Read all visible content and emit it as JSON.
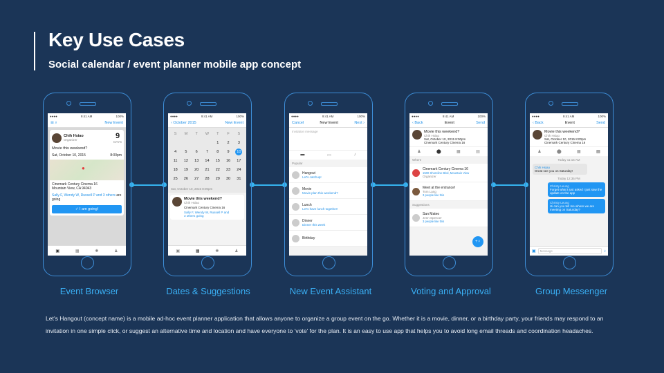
{
  "header": {
    "title": "Key Use Cases",
    "subtitle": "Social calendar / event planner mobile app concept"
  },
  "colors": {
    "background": "#1b3557",
    "accent": "#3ab0f5",
    "phone_outline": "#3e8fd9"
  },
  "phones": [
    {
      "label": "Event Browser",
      "status_time": "9:41 AM",
      "status_battery": "100%",
      "nav_right": "New Event",
      "host_name": "Chih Hsiao",
      "host_role": "Organizer",
      "days_count": "9",
      "days_label": "DAYS",
      "event_title": "Movie this weekend?",
      "event_date": "Sat, October 10, 2015",
      "event_time": "8:00pm",
      "venue_name": "Cinemark Century Cinema 16",
      "venue_city": "Mountain View, CA 94043",
      "attendees": "Sally F, Wendy W, Russell P and",
      "attendees_more": "3 others",
      "attendees_suffix": "are going",
      "cta": "✓  I am going!"
    },
    {
      "label": "Dates & Suggestions",
      "nav_left": "‹ October 2015",
      "nav_right": "New Event",
      "weekdays": [
        "S",
        "M",
        "T",
        "W",
        "T",
        "F",
        "S"
      ],
      "days": [
        "",
        "",
        "",
        "",
        "1",
        "2",
        "3",
        "4",
        "5",
        "6",
        "7",
        "8",
        "9",
        "10",
        "11",
        "12",
        "13",
        "14",
        "15",
        "16",
        "17",
        "18",
        "19",
        "20",
        "21",
        "22",
        "23",
        "24",
        "25",
        "26",
        "27",
        "28",
        "29",
        "30",
        "31"
      ],
      "selected_day": "10",
      "selected_date": "Sat, October 10, 2015  8:00pm",
      "event_title": "Movie this weekend?",
      "host_name": "Chih Hsiao",
      "venue_name": "Cinemark Century Cinema 16",
      "attendees": "Sally F, Wendy W, Russell P and",
      "attendees_more": "3 others going"
    },
    {
      "label": "New Event Assistant",
      "nav_left": "Cancel",
      "nav_title": "New Event",
      "nav_right": "Next ›",
      "input_placeholder": "Invitation message",
      "section_title": "Popular",
      "items": [
        {
          "title": "Hangout",
          "subtitle": "Let's catchup!"
        },
        {
          "title": "Movie",
          "subtitle": "Movie plan this weekend?"
        },
        {
          "title": "Lunch",
          "subtitle": "Let's have lunch together!"
        },
        {
          "title": "Dinner",
          "subtitle": "Dinner this week"
        },
        {
          "title": "Birthday",
          "subtitle": ""
        }
      ]
    },
    {
      "label": "Voting and Approval",
      "nav_left": "‹ Back",
      "nav_title": "Event",
      "nav_right": "Send",
      "event_title": "Movie this weekend?",
      "host_name": "Chih Hsiao",
      "event_date": "Sat, October 10, 2015  8:00pm",
      "venue_name": "Cinemark Century Cinema 16",
      "where_label": "Where",
      "where_title": "Cinemark Century Cinema 16",
      "where_address": "1500 Shoreline Blvd, Mountain View",
      "where_role": "Organizer",
      "where2_title": "Meet at the entrance!",
      "where2_sub": "Tom Lang",
      "where2_votes": "3 people like this",
      "suggestions_label": "Suggestions",
      "sugg_title": "San Mateo",
      "sugg_sub": "Jenn Spencer",
      "sugg_votes": "3 people like this",
      "fab": "+♀"
    },
    {
      "label": "Group Messenger",
      "nav_left": "‹ Back",
      "nav_title": "Event",
      "nav_right": "Send",
      "event_title": "Movie this weekend?",
      "host_name": "Chih Hsiao",
      "event_date": "Sat, October 10, 2015  8:00pm",
      "venue_name": "Cinemark Century Cinema 16",
      "time1": "Today 11:15 AM",
      "msg1_name": "Chih Hsiao",
      "msg1_text": "Great see you on Saturday!",
      "time2": "Today 12:35 PM",
      "msg2_name": "Christy Leung",
      "msg2_text": "Forget what I just asked I just saw the update on the app",
      "msg3_name": "Christy Leung",
      "msg3_text": "Hi can you tell me where we are meeting on Saturday?",
      "input_placeholder": "Message"
    }
  ],
  "description": "Let's Hangout (concept name) is a mobile ad-hoc event planner application that allows anyone to organize a group event on the go. Whether it is a movie, dinner, or a birthday party, your friends may respond to an invitation in one simple click, or suggest an alternative time and location and have everyone to 'vote' for the plan. It is an easy to use app that helps you to avoid long email threads and coordination headaches."
}
